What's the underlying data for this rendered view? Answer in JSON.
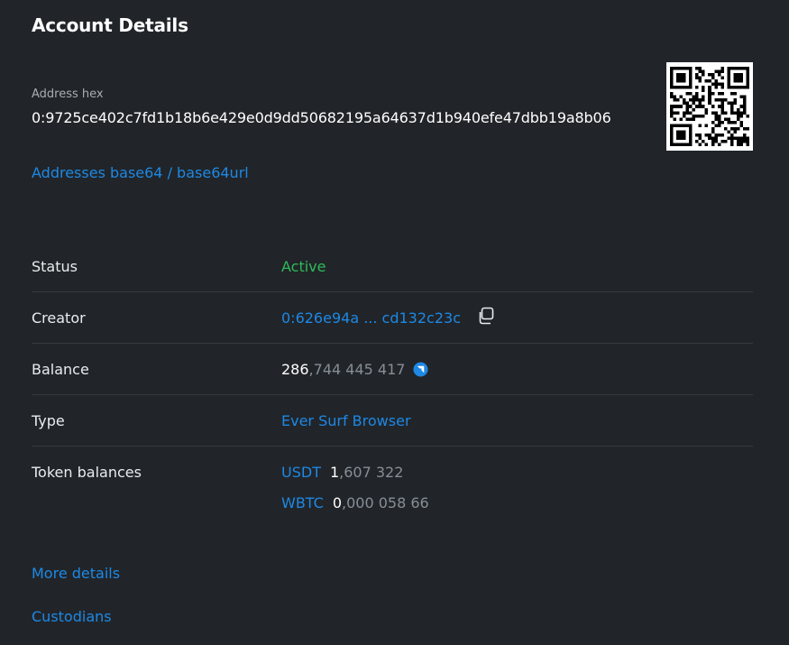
{
  "header": {
    "title": "Account Details"
  },
  "address": {
    "hex_label": "Address hex",
    "hex_value": "0:9725ce402c7fd1b18b6e429e0d9dd50682195a64637d1b940efe47dbb19a8b06",
    "base64_link": "Addresses base64 / base64url"
  },
  "details": {
    "status": {
      "label": "Status",
      "value": "Active"
    },
    "creator": {
      "label": "Creator",
      "value": "0:626e94a ... cd132c23c"
    },
    "balance": {
      "label": "Balance",
      "value_main": "286",
      "value_frac": ",744 445 417",
      "icon": "ever-coin-icon"
    },
    "type": {
      "label": "Type",
      "value": "Ever Surf Browser"
    },
    "tokens": {
      "label": "Token balances",
      "items": [
        {
          "symbol": "USDT",
          "main": "1",
          "frac": ",607 322"
        },
        {
          "symbol": "WBTC",
          "main": "0",
          "frac": ",000 058 66"
        }
      ]
    }
  },
  "links": {
    "more_details": "More details",
    "custodians": "Custodians"
  },
  "colors": {
    "background": "#212529",
    "link": "#1e88e5",
    "active": "#2fb95a",
    "divider": "#343a40"
  }
}
